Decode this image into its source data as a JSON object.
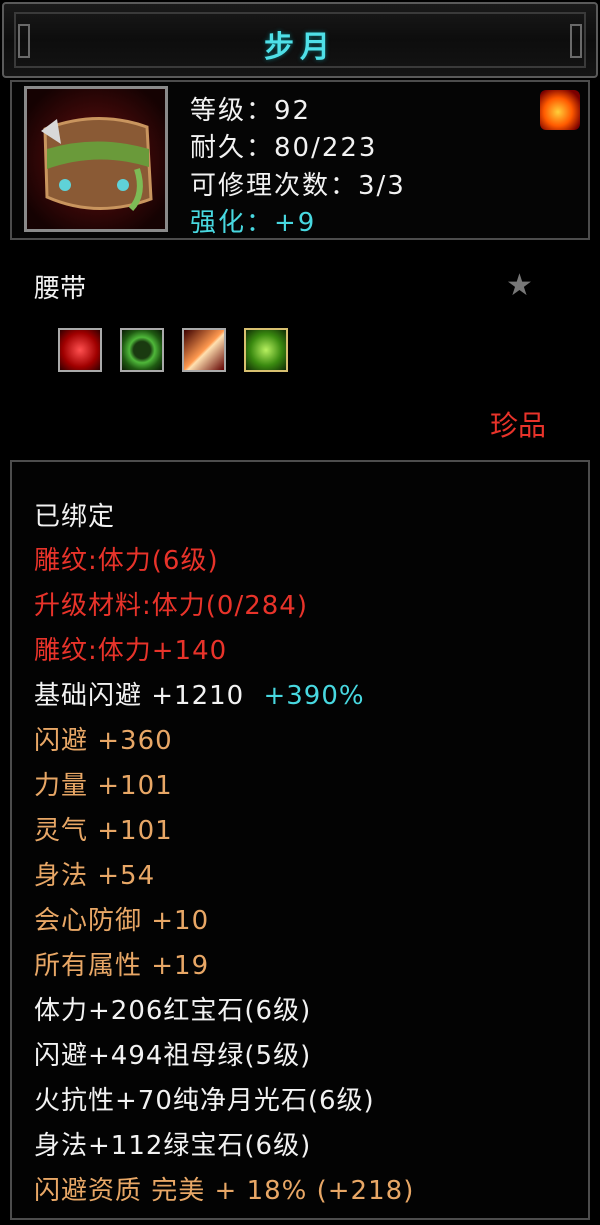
{
  "title": "步月",
  "stats": {
    "level": "等级：92",
    "durability": "耐久：80/223",
    "repair": "可修理次数：3/3",
    "enhance": "强化：+9"
  },
  "item_type": "腰带",
  "rarity": "珍品",
  "icons": {
    "item": "belt-icon",
    "corner": "fire-bird-icon",
    "star": "star-icon",
    "gems": [
      "red-gem-icon",
      "green-ring-icon",
      "flame-crystal-icon",
      "green-gem-icon"
    ]
  },
  "lines": {
    "bound": "已绑定",
    "engrave1": "雕纹:体力(6级)",
    "upgrade_material": "升级材料:体力(0/284)",
    "engrave2": "雕纹:体力+140",
    "base_dodge": "基础闪避  +1210",
    "base_dodge_pct": "+390%",
    "dodge": "闪避  +360",
    "strength": "力量  +101",
    "spirit": "灵气  +101",
    "agility": "身法  +54",
    "crit_def": "会心防御  +10",
    "all_attr": "所有属性  +19",
    "gem1": "体力+206红宝石(6级)",
    "gem2": "闪避+494祖母绿(5级)",
    "gem3": "火抗性+70纯净月光石(6级)",
    "gem4": "身法+112绿宝石(6级)",
    "quality": "闪避资质  完美  + 18% (+218)"
  },
  "colors": {
    "title": "#4fe0e8",
    "red": "#e8332a",
    "orange": "#e8a766",
    "cyan": "#48d8e0"
  }
}
